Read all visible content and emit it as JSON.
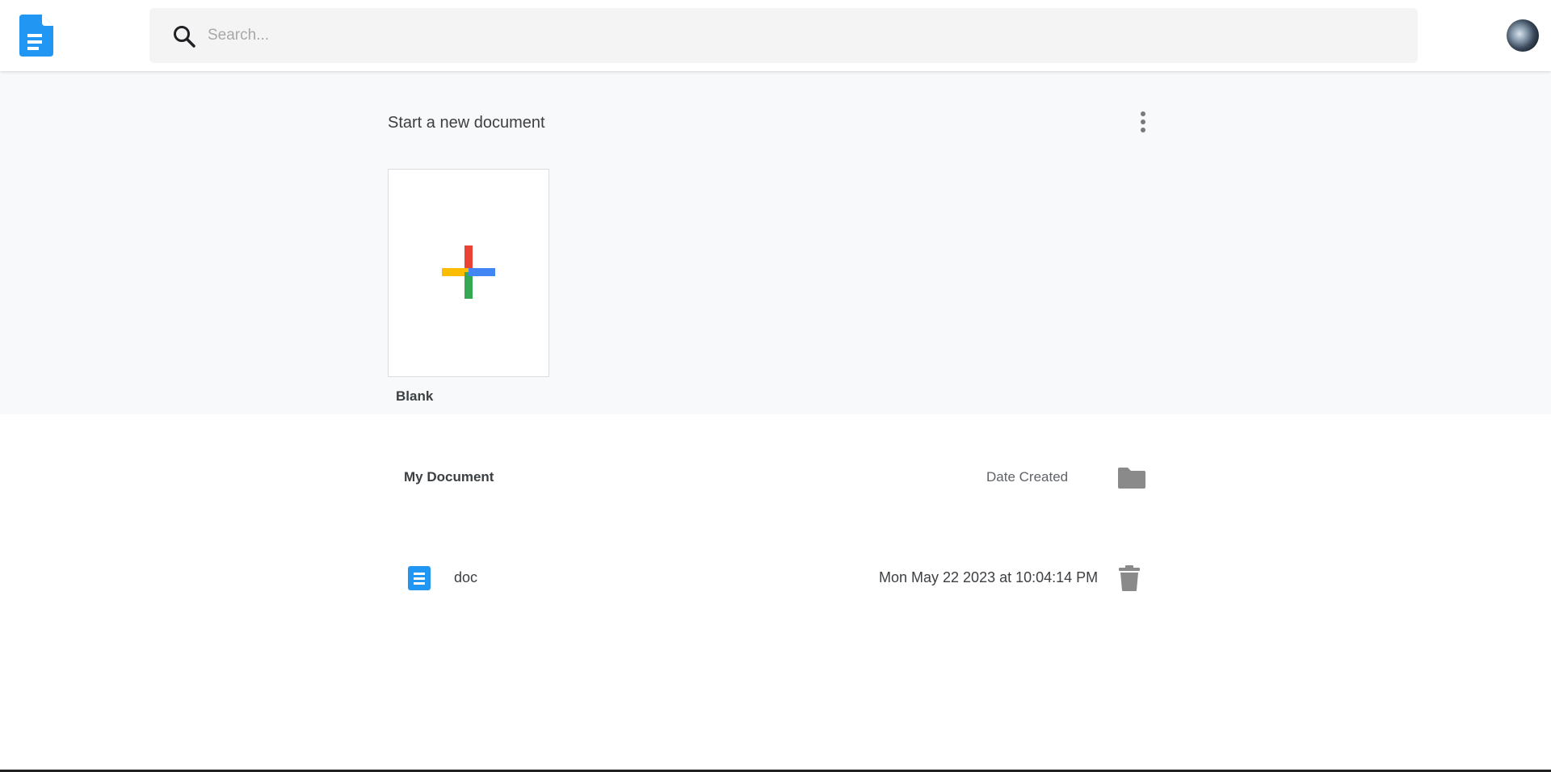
{
  "header": {
    "logo_icon": "docs-logo-icon",
    "search": {
      "placeholder": "Search...",
      "value": ""
    },
    "avatar_icon": "user-avatar"
  },
  "new_document": {
    "title": "Start a new document",
    "more_icon": "more-vert-icon",
    "templates": [
      {
        "label": "Blank",
        "icon": "plus-icon"
      }
    ]
  },
  "documents": {
    "header": {
      "title": "My Document",
      "date_label": "Date Created",
      "folder_icon": "folder-icon"
    },
    "rows": [
      {
        "name": "doc",
        "date": "Mon May 22 2023 at 10:04:14 PM",
        "icon": "doc-icon",
        "action_icon": "trash-icon"
      }
    ]
  },
  "colors": {
    "brand_blue": "#2196f3",
    "plus_red": "#ea4335",
    "plus_blue": "#4285f4",
    "plus_green": "#34a853",
    "plus_yellow": "#fbbc04",
    "section_bg": "#f8f9fa",
    "icon_gray": "#8a8a8a"
  }
}
